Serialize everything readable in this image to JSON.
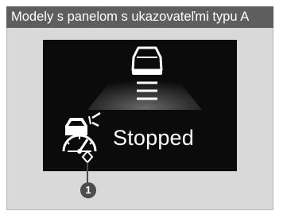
{
  "header": {
    "title": "Modely s panelom s ukazovateľmi typu A"
  },
  "display": {
    "status": "Stopped",
    "lane_icon": "lane-vehicle-icon",
    "indicator_icon": "vehicle-gauge-icon"
  },
  "callout": {
    "number": "1"
  },
  "colors": {
    "header_bg": "#5e5e5e",
    "panel_bg": "#d9d9d9",
    "screen_bg": "#0b0b0b",
    "glyph": "#ffffff",
    "badge": "#4c4c4c"
  }
}
